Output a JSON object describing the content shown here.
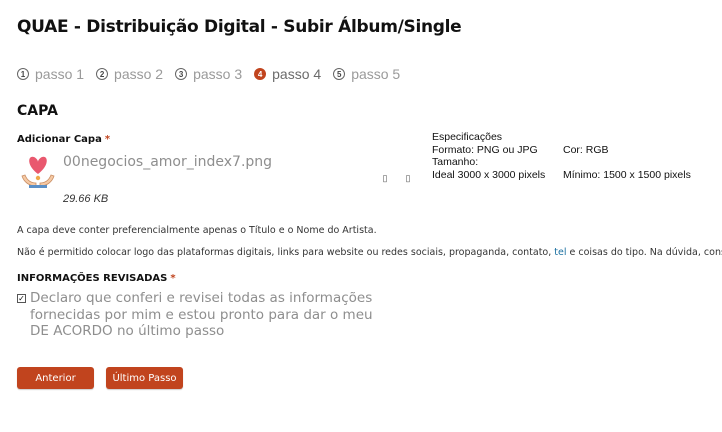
{
  "page": {
    "title": "QUAE - Distribuição Digital - Subir Álbum/Single"
  },
  "steps": [
    {
      "num": "1",
      "label": "passo 1",
      "active": false
    },
    {
      "num": "2",
      "label": "passo 2",
      "active": false
    },
    {
      "num": "3",
      "label": "passo 3",
      "active": false
    },
    {
      "num": "4",
      "label": "passo 4",
      "active": true
    },
    {
      "num": "5",
      "label": "passo 5",
      "active": false
    }
  ],
  "capa": {
    "section_title": "CAPA",
    "add_label": "Adicionar Capa",
    "required_mark": "*",
    "file": {
      "name": "00negocios_amor_index7.png",
      "size": "29.66 KB"
    },
    "specs": {
      "heading": "Especificações",
      "format": "Formato: PNG ou JPG",
      "color": "Cor: RGB",
      "size_heading": "Tamanho:",
      "ideal": "Ideal 3000 x 3000 pixels",
      "minimum": "Mínimo: 1500 x 1500 pixels"
    },
    "note1": "A capa deve conter preferencialmente apenas o Título e o Nome do Artista.",
    "note2_before": "Não é permitido colocar logo das plataformas digitais, links para website ou redes sociais, propaganda, contato, ",
    "note2_link": "tel",
    "note2_after": " e coisas do tipo. Na dúvida, consulte."
  },
  "review": {
    "label": "INFORMAÇÕES REVISADAS",
    "required_mark": "*",
    "checked_mark": "✓",
    "checkbox_text": "Declaro que conferi e revisei todas as informações fornecidas por mim e estou pronto para dar o meu DE ACORDO no último passo"
  },
  "buttons": {
    "previous": "Anterior",
    "last_step": "Último Passo"
  },
  "colors": {
    "accent": "#c1441e",
    "muted_text": "#8e8e8e"
  }
}
